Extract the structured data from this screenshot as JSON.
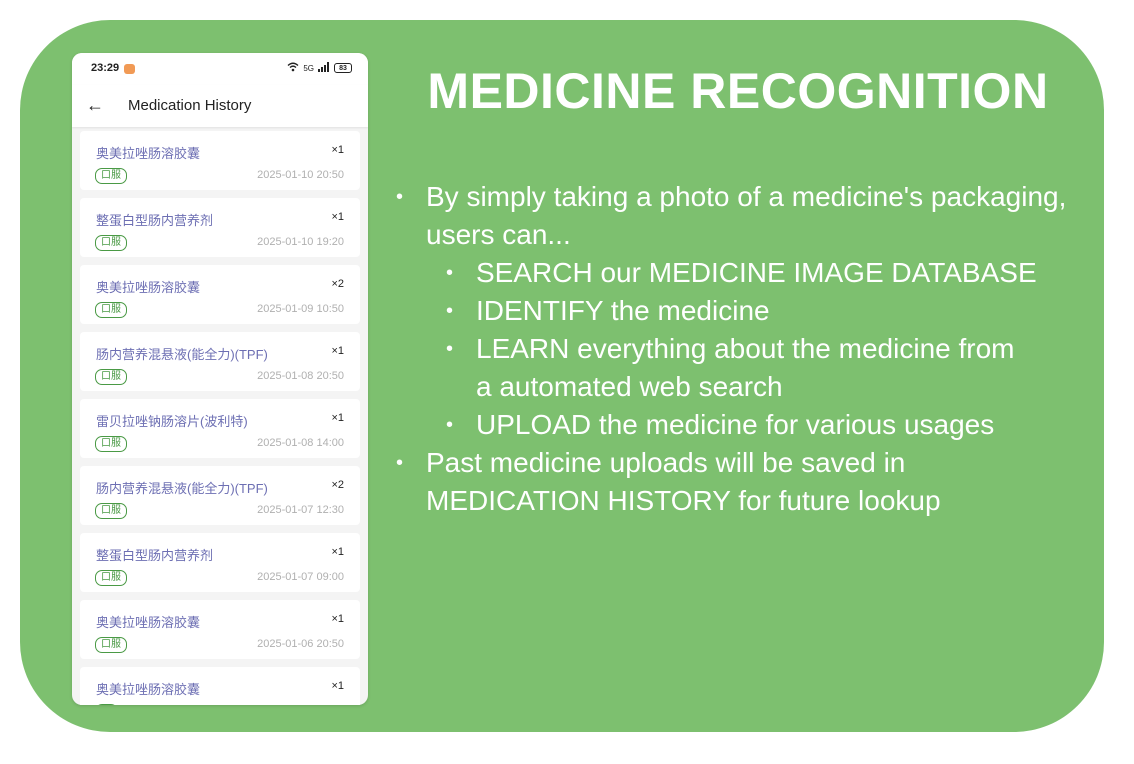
{
  "phone": {
    "status_bar": {
      "time": "23:29",
      "battery": "83",
      "signal": "5G"
    },
    "header": {
      "back_label": "←",
      "title": "Medication History"
    },
    "items": [
      {
        "name": "奥美拉唑肠溶胶囊",
        "qty": "×1",
        "tag": "口服",
        "date": "2025-01-10 20:50"
      },
      {
        "name": "整蛋白型肠内营养剂",
        "qty": "×1",
        "tag": "口服",
        "date": "2025-01-10 19:20"
      },
      {
        "name": "奥美拉唑肠溶胶囊",
        "qty": "×2",
        "tag": "口服",
        "date": "2025-01-09 10:50"
      },
      {
        "name": "肠内营养混悬液(能全力)(TPF)",
        "qty": "×1",
        "tag": "口服",
        "date": "2025-01-08 20:50"
      },
      {
        "name": "雷贝拉唑钠肠溶片(波利特)",
        "qty": "×1",
        "tag": "口服",
        "date": "2025-01-08 14:00"
      },
      {
        "name": "肠内营养混悬液(能全力)(TPF)",
        "qty": "×2",
        "tag": "口服",
        "date": "2025-01-07 12:30"
      },
      {
        "name": "整蛋白型肠内营养剂",
        "qty": "×1",
        "tag": "口服",
        "date": "2025-01-07 09:00"
      },
      {
        "name": "奥美拉唑肠溶胶囊",
        "qty": "×1",
        "tag": "口服",
        "date": "2025-01-06 20:50"
      },
      {
        "name": "奥美拉唑肠溶胶囊",
        "qty": "×1",
        "tag": "",
        "date": ""
      }
    ]
  },
  "slide": {
    "title": "MEDICINE RECOGNITION",
    "bullets": {
      "intro": "By simply taking a photo of a medicine's packaging, users can...",
      "sub": [
        "SEARCH our MEDICINE IMAGE DATABASE",
        "IDENTIFY the medicine",
        "LEARN everything about the medicine from a automated web search",
        "UPLOAD the medicine for various usages"
      ],
      "outro": "Past medicine uploads will be saved in MEDICATION HISTORY for future lookup"
    }
  },
  "colors": {
    "background": "#7dc06f",
    "accent_text": "#6d6fb3",
    "tag": "#4a9a45"
  }
}
